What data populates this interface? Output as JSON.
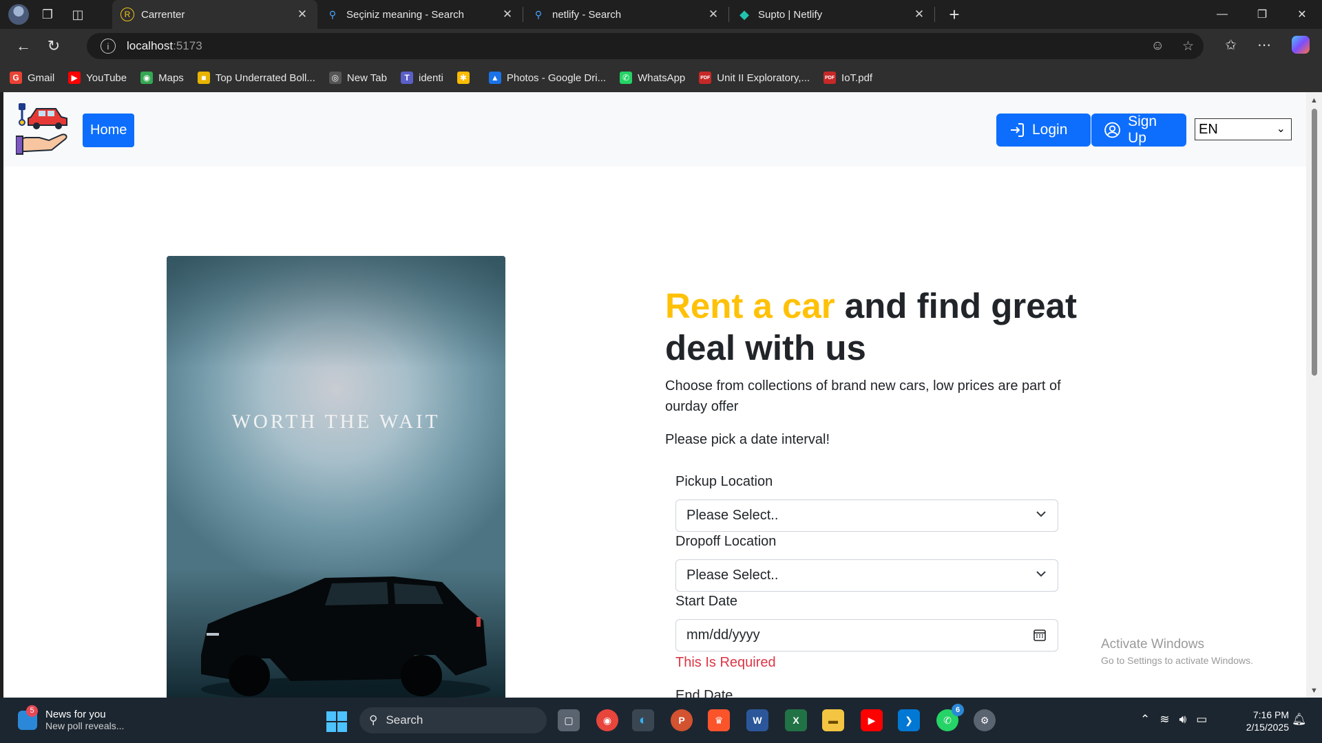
{
  "browser": {
    "tabs": [
      {
        "title": "Carrenter",
        "favicon": "R",
        "active": true
      },
      {
        "title": "Seçiniz meaning - Search",
        "favicon": "search-icon",
        "active": false
      },
      {
        "title": "netlify - Search",
        "favicon": "search-icon",
        "active": false
      },
      {
        "title": "Supto | Netlify",
        "favicon": "netlify-icon",
        "active": false
      }
    ],
    "address": {
      "host": "localhost",
      "port": ":5173"
    },
    "bookmarks": [
      {
        "label": "Gmail",
        "icon": "G",
        "color": "#ea4335"
      },
      {
        "label": "YouTube",
        "icon": "▶",
        "color": "#ff0000"
      },
      {
        "label": "Maps",
        "icon": "◉",
        "color": "#34a853"
      },
      {
        "label": "Top Underrated Boll...",
        "icon": "■",
        "color": "#e8b400"
      },
      {
        "label": "New Tab",
        "icon": "◎",
        "color": "#555555"
      },
      {
        "label": "identi",
        "icon": "T",
        "color": "#5b5fc7"
      },
      {
        "label": "",
        "icon": "✱",
        "color": "#fbbc04"
      },
      {
        "label": "Photos - Google Dri...",
        "icon": "▲",
        "color": "#1a73e8"
      },
      {
        "label": "WhatsApp",
        "icon": "✆",
        "color": "#25d366"
      },
      {
        "label": "Unit II Exploratory,...",
        "icon": "PDF",
        "color": "#c62828"
      },
      {
        "label": "IoT.pdf",
        "icon": "PDF",
        "color": "#c62828"
      }
    ]
  },
  "page": {
    "nav": {
      "home_label": "Home",
      "login_label": "Login",
      "signup_label": "Sign Up",
      "language": "EN"
    },
    "hero": {
      "image_tagline": "WORTH THE WAIT",
      "headline_accent": "Rent a car",
      "headline_rest": " and find great deal with us",
      "lead": "Choose from collections of brand new cars, low prices are part of ourday offer",
      "pick_prompt": "Please pick a date interval!"
    },
    "form": {
      "pickup_label": "Pickup Location",
      "pickup_value": "Please Select..",
      "dropoff_label": "Dropoff Location",
      "dropoff_value": "Please Select..",
      "start_label": "Start Date",
      "start_placeholder": "mm/dd/yyyy",
      "start_error": "This Is Required",
      "end_label": "End Date"
    },
    "colors": {
      "primary": "#0d6efd",
      "accent": "#ffc107",
      "error": "#dc3545"
    }
  },
  "os": {
    "watermark_title": "Activate Windows",
    "watermark_sub": "Go to Settings to activate Windows.",
    "news_title": "News for you",
    "news_sub": "New poll reveals...",
    "news_badge": "5",
    "search_label": "Search",
    "whatsapp_badge": "6",
    "time": "7:16 PM",
    "date": "2/15/2025"
  }
}
